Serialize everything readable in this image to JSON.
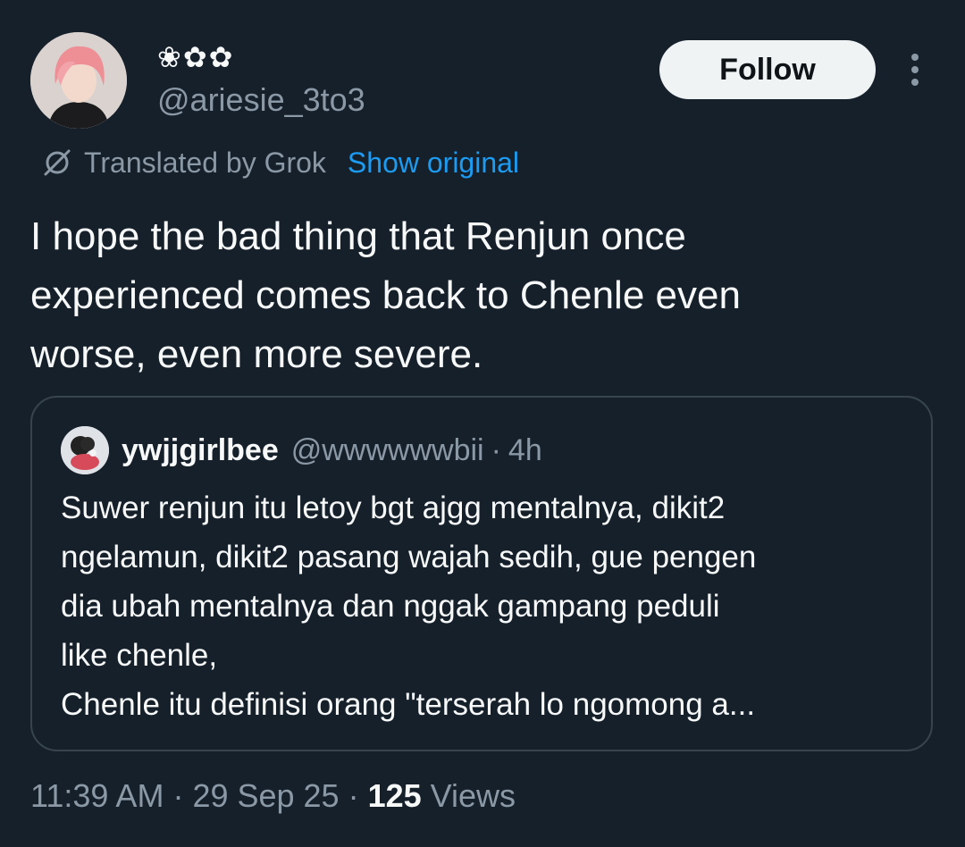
{
  "author": {
    "display_name": "❀✿✿",
    "handle": "@ariesie_3to3",
    "avatar_icon": "user-avatar-pink-hair"
  },
  "actions": {
    "follow_label": "Follow",
    "more_icon": "more-vertical-icon"
  },
  "translation": {
    "icon": "grok-icon",
    "label": "Translated by Grok",
    "show_original_label": "Show original"
  },
  "tweet": {
    "text": "I hope the bad thing that Renjun once\nexperienced comes back to Chenle even\nworse, even more severe."
  },
  "quote": {
    "display_name": "ywjjgirlbee",
    "handle": "@wwwwwwbii",
    "separator": "·",
    "time": "4h",
    "text": "Suwer renjun itu letoy bgt ajgg mentalnya, dikit2\nngelamun, dikit2 pasang wajah sedih, gue pengen\ndia ubah mentalnya dan nggak gampang peduli\nlike chenle,\nChenle itu definisi orang \"terserah lo ngomong a..."
  },
  "meta": {
    "time": "11:39 AM",
    "separator": "·",
    "date": "29 Sep 25",
    "views_count": "125",
    "views_label": "Views"
  },
  "colors": {
    "background": "#15202b",
    "text_primary": "#f7f9f9",
    "text_secondary": "#8b98a5",
    "link": "#1d9bf0",
    "border": "#38444d",
    "follow_bg": "#eff3f4"
  }
}
